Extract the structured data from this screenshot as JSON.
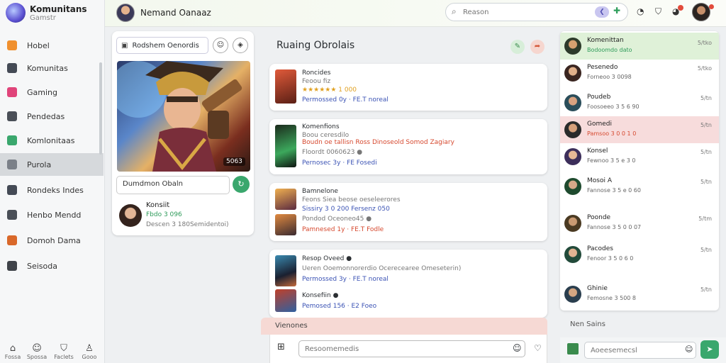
{
  "brand": {
    "title": "Komunitans",
    "subtitle": "Gamstr"
  },
  "sidebar": {
    "items": [
      {
        "label": "Hobel",
        "color": "#f0902e"
      },
      {
        "label": "Komunitas",
        "color": "#444a55"
      },
      {
        "label": "Gaming",
        "color": "#e0447a"
      },
      {
        "label": "Pendedas",
        "color": "#4a4f57"
      },
      {
        "label": "Komlonitaas",
        "color": "#3aa76d"
      },
      {
        "label": "Purola",
        "color": "#7b8088"
      },
      {
        "label": "Rondeks Indes",
        "color": "#444a55"
      },
      {
        "label": "Henbo Mendd",
        "color": "#4a4f57"
      },
      {
        "label": "Domoh Dama",
        "color": "#d9682a"
      },
      {
        "label": "Seisoda",
        "color": "#3f4349"
      }
    ],
    "bottom": [
      {
        "icon": "⌂",
        "label": "Fossa"
      },
      {
        "icon": "☺",
        "label": "Spossa"
      },
      {
        "icon": "⛉",
        "label": "Faclets"
      },
      {
        "icon": "♙",
        "label": "Gooo"
      }
    ]
  },
  "topbar": {
    "title": "Nemand Oanaaz",
    "search_placeholder": "Reason",
    "search_pill": "❮"
  },
  "game_card": {
    "title": "Rodshem Oenordis",
    "badge": "5063",
    "input_value": "Dumdmon Obaln",
    "user": {
      "name": "Konsiit",
      "line1": "Fbdo 3 096",
      "line2": "Descen 3 180Semidentoi)"
    }
  },
  "feed": {
    "title": "Ruaing Obrolais",
    "posts": [
      {
        "lines": [
          {
            "text": "Roncides",
            "cls": "dark"
          },
          {
            "text": "Feoou fiz",
            "cls": "grey"
          },
          {
            "text": "★★★★★★ 1 000",
            "cls": "gold"
          },
          {
            "text": "Permossed 0y · FE.T noreal",
            "cls": "blue"
          }
        ]
      },
      {
        "lines": [
          {
            "text": "Komenfions",
            "cls": "dark"
          },
          {
            "text": "Boou ceresdilo",
            "cls": "grey"
          },
          {
            "text": "Boudn oe tallisn Ross Dinoseold Somod Zagiary",
            "cls": "red"
          },
          {
            "text": "Floordt 0060623 ●",
            "cls": "grey"
          },
          {
            "text": "Pernosec 3y · FE Fosedi",
            "cls": "blue"
          }
        ]
      },
      {
        "lines": [
          {
            "text": "Bamnelone",
            "cls": "dark"
          },
          {
            "text": "Feons Siea beose oeseleerores",
            "cls": "grey"
          },
          {
            "text": "Sissiry 3 0 200 Fersenz 050",
            "cls": "blue"
          },
          {
            "text": "Pondod Oceoneo45 ●",
            "cls": "grey"
          },
          {
            "text": "Pamnesed 1y · FE.T Fodle",
            "cls": "red"
          }
        ]
      },
      {
        "lines": [
          {
            "text": "Resop Oveed ●",
            "cls": "dark"
          },
          {
            "text": "Ueren Ooemonnorerdio Ocerecearee Omeseterin)",
            "cls": "grey"
          },
          {
            "text": "Permossed 3y · FE.T noreal",
            "cls": "blue"
          },
          {
            "text": "Konsefiin ●",
            "cls": "dark"
          },
          {
            "text": "Pemosed 156 · E2 Foeo",
            "cls": "blue"
          }
        ]
      }
    ]
  },
  "composer": {
    "label": "Vienones",
    "placeholder": "Resoomemedis"
  },
  "friends": {
    "items": [
      {
        "name": "Komenittan",
        "status": "Bodoomdo dato",
        "time": "5/tko",
        "highlight": "green",
        "status_color": "#2e9b5a"
      },
      {
        "name": "Pesenedo",
        "status": "Forneoo 3 0098",
        "time": "5/tko",
        "highlight": "",
        "status_color": "#666"
      },
      {
        "name": "Poudeb",
        "status": "Foosoeeo 3 5 6 90",
        "time": "5/tn",
        "highlight": "",
        "status_color": "#666"
      },
      {
        "name": "Gomedi",
        "status": "Pamsoo 3 0 0 1 0",
        "time": "5/tn",
        "highlight": "red",
        "status_color": "#d6492f"
      },
      {
        "name": "Konsel",
        "status": "Fewnoo 3 5 e 3 0",
        "time": "5/tn",
        "highlight": "",
        "status_color": "#666"
      },
      {
        "name": "Mosoi A",
        "status": "Fannose 3 5 e 0 60",
        "time": "5/tn",
        "highlight": "",
        "status_color": "#666"
      },
      {
        "name": "Poonde",
        "status": "Fannose 3 5 0 0 07",
        "time": "5/tm",
        "highlight": "",
        "status_color": "#666"
      },
      {
        "name": "Pacodes",
        "status": "Fenoor 3 5 0 6 0",
        "time": "5/tn",
        "highlight": "",
        "status_color": "#666"
      },
      {
        "name": "Ghinie",
        "status": "Femosne 3 500 8",
        "time": "5/tn",
        "highlight": "",
        "status_color": "#666"
      }
    ],
    "footer_label": "Nen Sains",
    "input_placeholder": "Aoeesemecsl"
  }
}
